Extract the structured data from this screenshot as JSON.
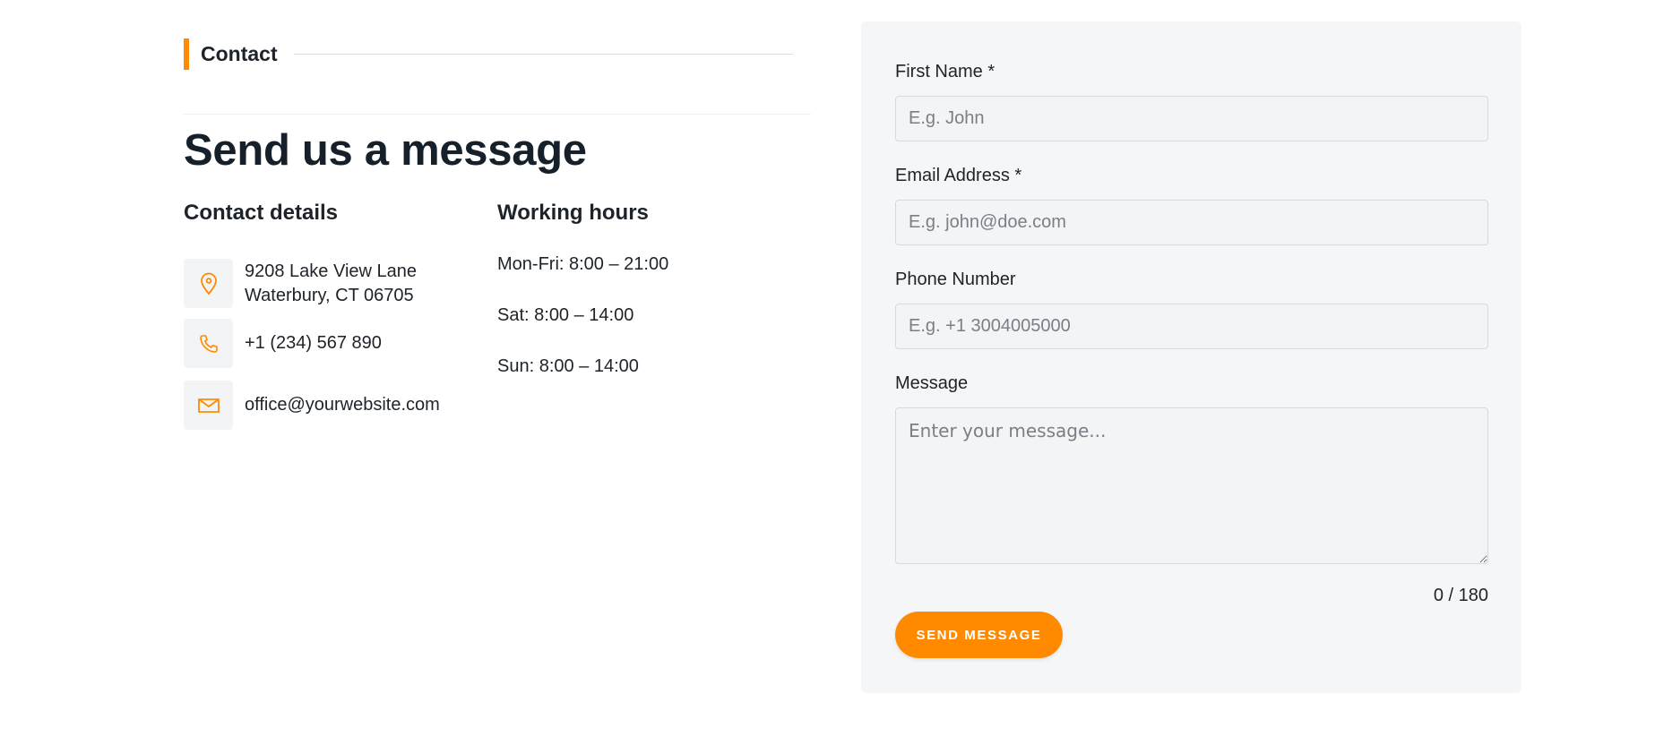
{
  "section_tag": "Contact",
  "heading": "Send us a message",
  "contact_details": {
    "title": "Contact details",
    "address_line1": "9208 Lake View Lane",
    "address_line2": "Waterbury, CT 06705",
    "phone": "+1 (234) 567 890",
    "email": "office@yourwebsite.com"
  },
  "working_hours": {
    "title": "Working hours",
    "lines": [
      "Mon-Fri: 8:00 – 21:00",
      "Sat: 8:00 – 14:00",
      "Sun: 8:00 – 14:00"
    ]
  },
  "form": {
    "first_name_label": "First Name *",
    "first_name_placeholder": "E.g. John",
    "email_label": "Email Address *",
    "email_placeholder": "E.g. john@doe.com",
    "phone_label": "Phone Number",
    "phone_placeholder": "E.g. +1 3004005000",
    "message_label": "Message",
    "message_placeholder": "Enter your message...",
    "counter": "0 / 180",
    "submit_label": "SEND MESSAGE"
  },
  "colors": {
    "accent": "#ff8a00",
    "panel_bg": "#f5f6f8",
    "text": "#1d2329"
  },
  "icons": {
    "address": "map-pin-icon",
    "phone": "phone-icon",
    "email": "mail-icon"
  }
}
